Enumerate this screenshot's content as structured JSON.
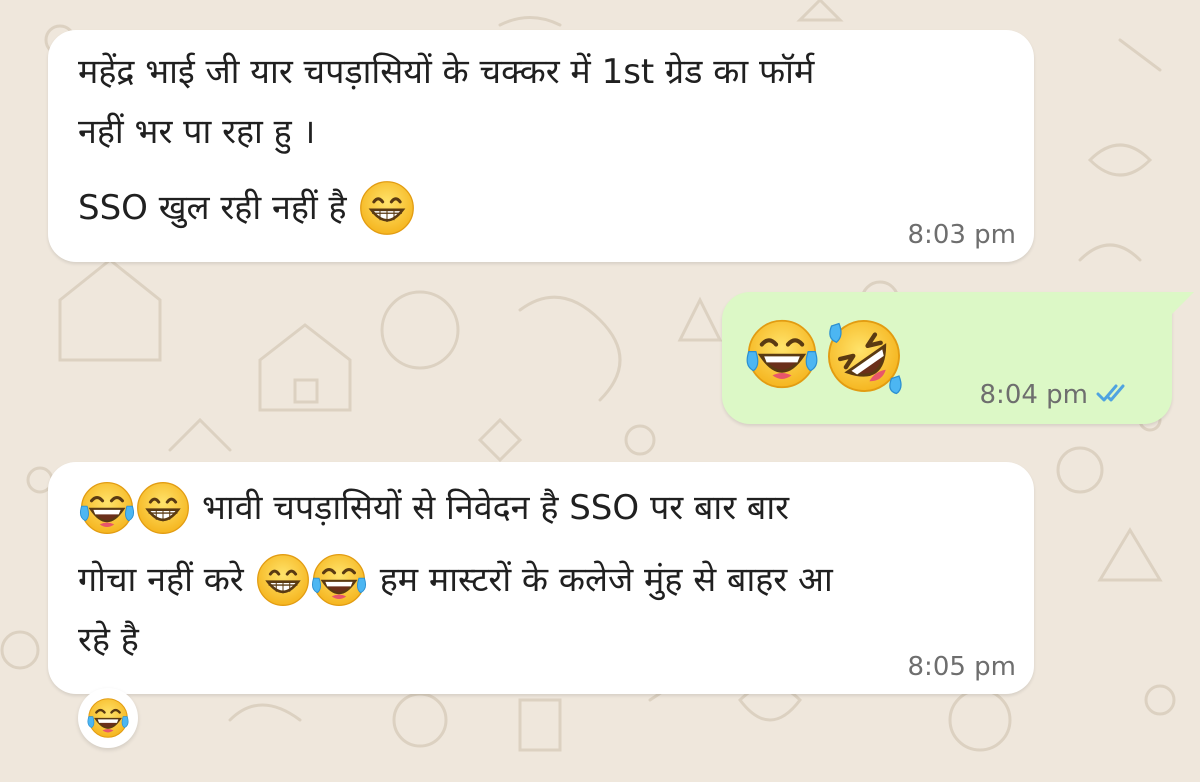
{
  "messages": [
    {
      "direction": "incoming",
      "lines": [
        "महेंद्र भाई जी यार चपड़ासियों के चक्कर में 1st ग्रेड का फॉर्म",
        "नहीं भर पा रहा हु ।",
        "SSO खुल रही नहीं है"
      ],
      "emoji": [
        "grinning-face-with-smiling-eyes"
      ],
      "time": "8:03 pm"
    },
    {
      "direction": "outgoing",
      "emoji": [
        "face-with-tears-of-joy",
        "rolling-on-the-floor-laughing"
      ],
      "time": "8:04 pm",
      "status": "read-double-check",
      "status_color": "#4fa3e0"
    },
    {
      "direction": "incoming",
      "line1_text": "भावी चपड़ासियों से निवेदन है SSO पर बार बार",
      "line2_a": "गोचा नहीं करे",
      "line2_b": "हम मास्टरों के कलेजे मुंह से बाहर आ",
      "line3": "रहे है",
      "emoji": [
        "face-with-tears-of-joy",
        "grinning-face-with-smiling-eyes"
      ],
      "time": "8:05 pm",
      "reaction": "face-with-tears-of-joy"
    }
  ],
  "colors": {
    "background": "#efe7dc",
    "incoming_bubble": "#ffffff",
    "outgoing_bubble": "#dcf8c6",
    "timestamp": "#6e6e6e",
    "read_ticks": "#4fa3e0"
  }
}
